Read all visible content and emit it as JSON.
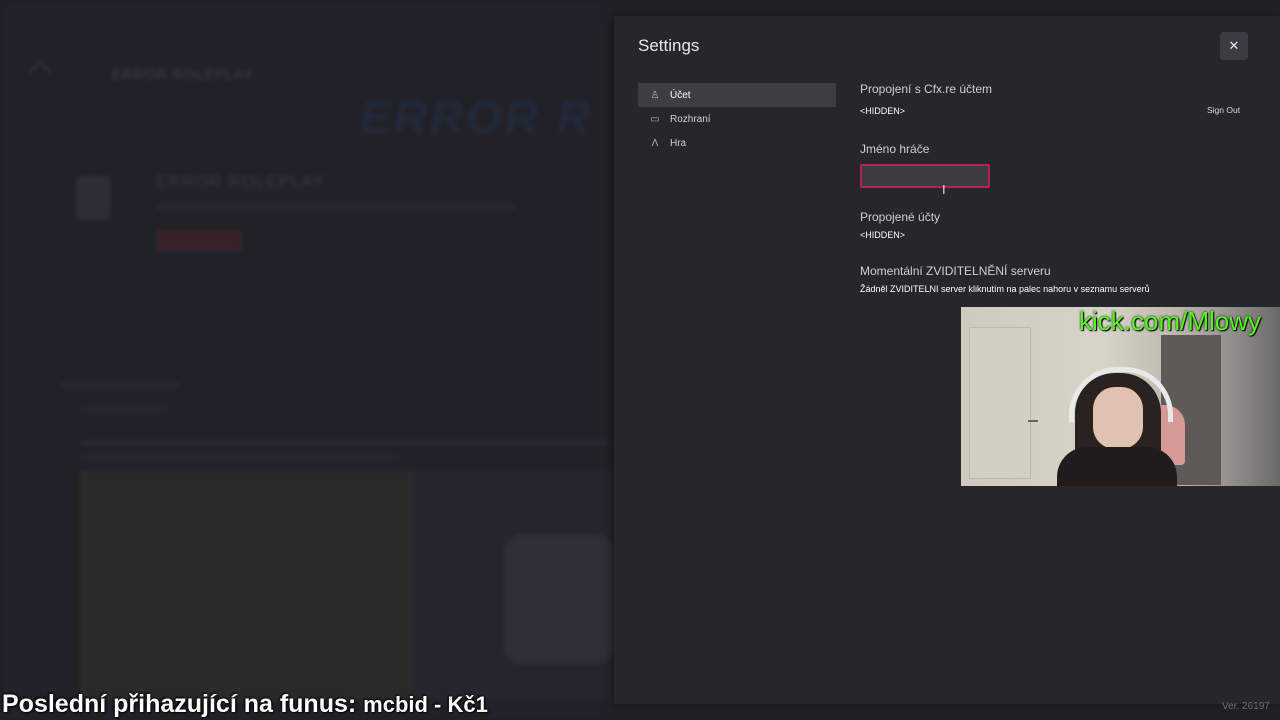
{
  "background_app": {
    "title": "ERROR ROLEPLAY",
    "banner": "ERROR R",
    "server_name": "ERROR ROLEPLAY"
  },
  "settings": {
    "title": "Settings",
    "close_icon": "close-icon",
    "nav": [
      {
        "label": "Účet",
        "icon": "user-icon",
        "active": true
      },
      {
        "label": "Rozhraní",
        "icon": "monitor-icon",
        "active": false
      },
      {
        "label": "Hra",
        "icon": "game-icon",
        "active": false
      }
    ],
    "account": {
      "cfx_title": "Propojení s Cfx.re účtem",
      "cfx_value": "<HIDDEN>",
      "sign_out": "Sign Out",
      "player_name_title": "Jméno hráče",
      "player_name_value": "",
      "linked_title": "Propojené účty",
      "linked_value": "<HIDDEN>",
      "boost_title": "Momentální ZVIDITELNĚNÍ serveru",
      "boost_note": "Žádněl ZVIDITELNI server kliknutím na palec nahoru v seznamu serverů"
    }
  },
  "overlay": {
    "kick_url": "kick.com/Mlowy",
    "bidder_label": "Poslední přihazující na funus:",
    "bidder_value": "mcbid - Kč1"
  },
  "version": "Ver. 26197"
}
